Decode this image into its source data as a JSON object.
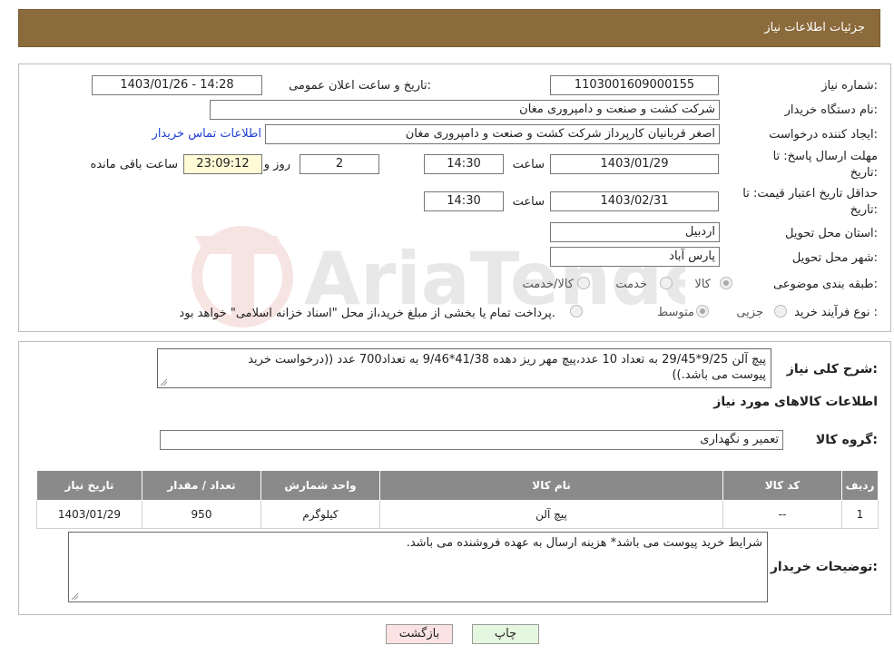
{
  "header": {
    "title": "جزئیات اطلاعات نیاز"
  },
  "fields": {
    "need_number_label": "شماره نیاز:",
    "need_number": "1103001609000155",
    "announce_label": "تاریخ و ساعت اعلان عمومی:",
    "announce_value": "1403/01/26 - 14:28",
    "buyer_org_label": "نام دستگاه خریدار:",
    "buyer_org": "شرکت کشت و صنعت و دامپروری مغان",
    "requester_label": "ایجاد کننده درخواست:",
    "requester": "اصغر قربانیان کارپرداز شرکت کشت و صنعت و دامپروری مغان",
    "contact_link": "اطلاعات تماس خریدار",
    "deadline_label_1": "مهلت ارسال پاسخ: تا",
    "deadline_label_2": "تاریخ:",
    "deadline_date": "1403/01/29",
    "time_label": "ساعت",
    "deadline_time": "14:30",
    "days_value": "2",
    "days_label": "روز و",
    "remaining_value": "23:09:12",
    "remaining_label": "ساعت باقی مانده",
    "validity_label_1": "حداقل تاریخ اعتبار قیمت: تا",
    "validity_label_2": "تاریخ:",
    "validity_date": "1403/02/31",
    "validity_time": "14:30",
    "province_label": "استان محل تحویل:",
    "province": "اردبیل",
    "city_label": "شهر محل تحویل:",
    "city": "پارس آباد",
    "category_label": "طبقه بندی موضوعی:",
    "category_options": [
      "کالا",
      "خدمت",
      "کالا/خدمت"
    ],
    "process_label": "نوع فرآیند خرید :",
    "process_options": [
      "جزیی",
      "متوسط"
    ],
    "process_note": "پرداخت تمام یا بخشی از مبلغ خرید،از محل \"اسناد خزانه اسلامی\" خواهد بود."
  },
  "description": {
    "label": "شرح کلی نیاز:",
    "line1": "پیچ آلن 9/25*29/45 به تعداد 10 عدد،پیچ مهر ریز دهده 41/38*9/46 به تعداد700 عدد ((درخواست خرید",
    "line2": "پیوست می باشد.))"
  },
  "goods": {
    "section_title": "اطلاعات کالاهای مورد نیاز",
    "group_label": "گروه کالا:",
    "group_value": "تعمیر و نگهداری",
    "columns": [
      "ردیف",
      "کد کالا",
      "نام کالا",
      "واحد شمارش",
      "تعداد / مقدار",
      "تاریخ نیاز"
    ],
    "rows": [
      [
        "1",
        "--",
        "پیچ آلن",
        "کیلوگرم",
        "950",
        "1403/01/29"
      ]
    ]
  },
  "buyer_notes": {
    "label": "توضیحات خریدار:",
    "text": "شرایط خرید پیوست می باشد* هزینه ارسال به عهده فروشنده می باشد."
  },
  "buttons": {
    "print": "چاپ",
    "back": "بازگشت"
  },
  "watermark_text": "AriaTender.neT"
}
